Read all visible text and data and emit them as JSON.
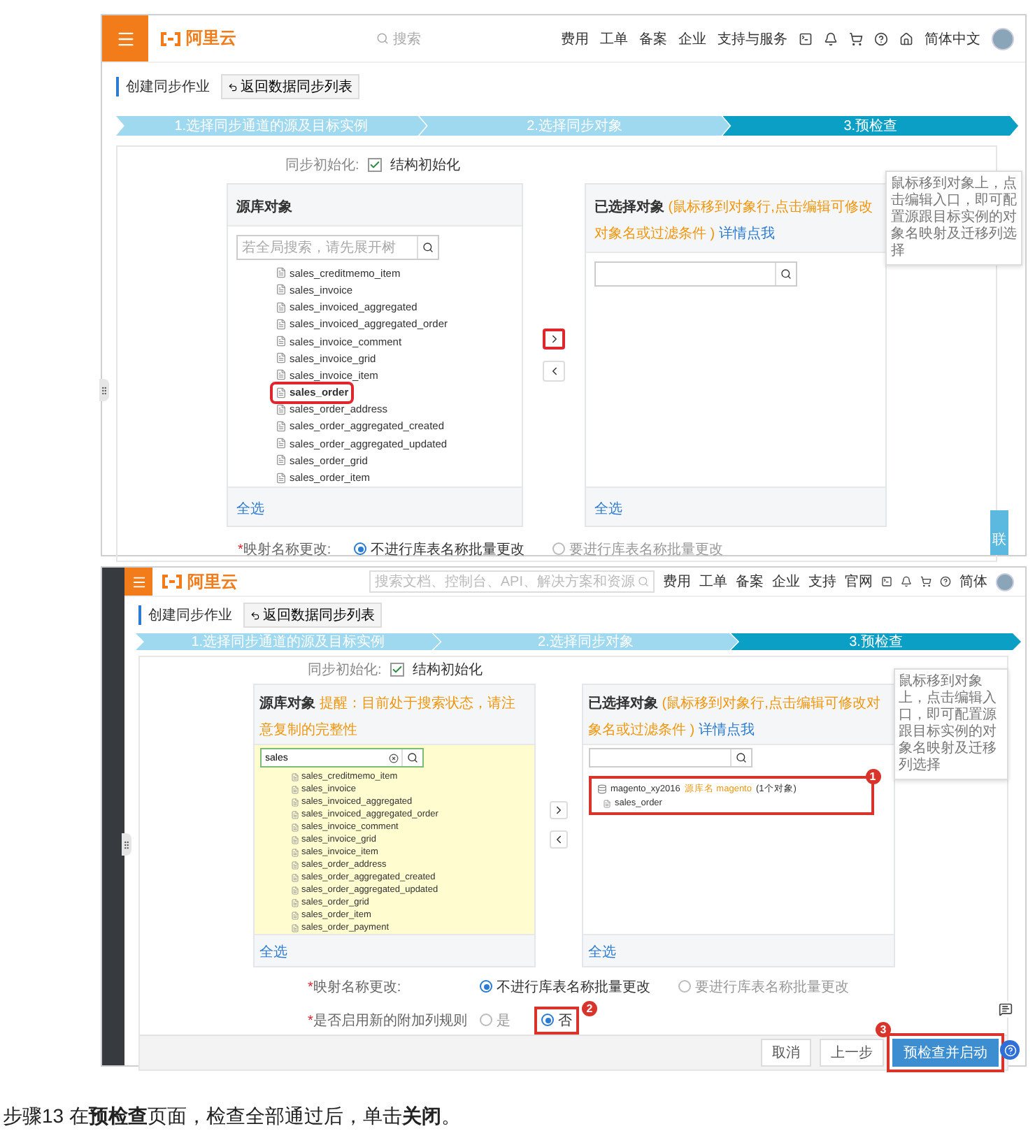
{
  "screenshots": [
    {
      "kind": "full",
      "header": {
        "logo": "阿里云",
        "search": {
          "placeholder": "搜索"
        },
        "nav": [
          "费用",
          "工单",
          "备案",
          "企业",
          "支持与服务"
        ],
        "language": "简体中文"
      },
      "page_title": "创建同步作业",
      "back_button": "返回数据同步列表",
      "steps": [
        {
          "label": "1.选择同步通道的源及目标实例",
          "selected": false
        },
        {
          "label": "2.选择同步对象",
          "selected": false
        },
        {
          "label": "3.预检查",
          "selected": true
        }
      ],
      "sync_init": {
        "label": "同步初始化:",
        "option": "结构初始化",
        "checked": true
      },
      "source": {
        "title": "源库对象",
        "search": {
          "placeholder": "若全局搜索，请先展开树"
        },
        "filtered": false,
        "items": [
          {
            "label": "sales_creditmemo_item",
            "marked": false
          },
          {
            "label": "sales_invoice",
            "marked": false
          },
          {
            "label": "sales_invoiced_aggregated",
            "marked": false
          },
          {
            "label": "sales_invoiced_aggregated_order",
            "marked": false
          },
          {
            "label": "sales_invoice_comment",
            "marked": false
          },
          {
            "label": "sales_invoice_grid",
            "marked": false
          },
          {
            "label": "sales_invoice_item",
            "marked": false
          },
          {
            "label": "sales_order",
            "marked": true
          },
          {
            "label": "sales_order_address",
            "marked": false
          },
          {
            "label": "sales_order_aggregated_created",
            "marked": false
          },
          {
            "label": "sales_order_aggregated_updated",
            "marked": false
          },
          {
            "label": "sales_order_grid",
            "marked": false
          },
          {
            "label": "sales_order_item",
            "marked": false
          }
        ],
        "select_all": "全选"
      },
      "transfer": [
        {
          "kind": "right",
          "marked": true
        },
        {
          "kind": "left",
          "marked": false
        }
      ],
      "target": {
        "title": "已选择对象",
        "hint": "(鼠标移到对象行,点击编辑可修改对象名或过滤条件 )",
        "link": "详情点我",
        "select_all": "全选"
      },
      "tooltip": "鼠标移到对象上，点击编辑入口，即可配置源跟目标实例的对象名映射及迁移列选择",
      "options": [
        {
          "required_mark": "*",
          "label": "映射名称更改:",
          "choices": [
            {
              "label": "不进行库表名称批量更改",
              "selected": true
            },
            {
              "label": "要进行库表名称批量更改",
              "selected": false
            }
          ]
        }
      ],
      "contact_tab": "联"
    },
    {
      "kind": "compact",
      "header": {
        "logo": "阿里云",
        "search": {
          "placeholder": "搜索文档、控制台、API、解决方案和资源"
        },
        "nav": [
          "费用",
          "工单",
          "备案",
          "企业",
          "支持",
          "官网"
        ],
        "language": "简体"
      },
      "page_title": "创建同步作业",
      "back_button": "返回数据同步列表",
      "steps": [
        {
          "label": "1.选择同步通道的源及目标实例",
          "selected": false
        },
        {
          "label": "2.选择同步对象",
          "selected": false
        },
        {
          "label": "3.预检查",
          "selected": true
        }
      ],
      "sync_init": {
        "label": "同步初始化:",
        "option": "结构初始化",
        "checked": true
      },
      "source": {
        "title": "源库对象",
        "notice": "提醒：目前处于搜索状态，请注意复制的完整性",
        "search": {
          "value": "sales"
        },
        "filtered": true,
        "items": [
          {
            "label": "sales_creditmemo_item",
            "marked": false
          },
          {
            "label": "sales_invoice",
            "marked": false
          },
          {
            "label": "sales_invoiced_aggregated",
            "marked": false
          },
          {
            "label": "sales_invoiced_aggregated_order",
            "marked": false
          },
          {
            "label": "sales_invoice_comment",
            "marked": false
          },
          {
            "label": "sales_invoice_grid",
            "marked": false
          },
          {
            "label": "sales_invoice_item",
            "marked": false
          },
          {
            "label": "sales_order_address",
            "marked": false
          },
          {
            "label": "sales_order_aggregated_created",
            "marked": false
          },
          {
            "label": "sales_order_aggregated_updated",
            "marked": false
          },
          {
            "label": "sales_order_grid",
            "marked": false
          },
          {
            "label": "sales_order_item",
            "marked": false
          },
          {
            "label": "sales_order_payment",
            "marked": false
          }
        ],
        "select_all": "全选"
      },
      "transfer": [
        {
          "kind": "right",
          "marked": false
        },
        {
          "kind": "left",
          "marked": false
        }
      ],
      "target": {
        "title": "已选择对象",
        "hint": "(鼠标移到对象行,点击编辑可修改对象名或过滤条件 )",
        "link": "详情点我",
        "callout": "1",
        "items": [
          {
            "label": "magento_xy2016",
            "note": "源库名 magento",
            "count": "(1个对象)",
            "children": [
              {
                "label": "sales_order"
              }
            ]
          }
        ],
        "select_all": "全选"
      },
      "tooltip": "鼠标移到对象上，点击编辑入口，即可配置源跟目标实例的对象名映射及迁移列选择",
      "options": [
        {
          "required_mark": "*",
          "label": "映射名称更改:",
          "choices": [
            {
              "label": "不进行库表名称批量更改",
              "selected": true
            },
            {
              "label": "要进行库表名称批量更改",
              "selected": false
            }
          ]
        },
        {
          "required_mark": "*",
          "label": "是否启用新的附加列规则",
          "choices": [
            {
              "label": "是",
              "selected": false
            },
            {
              "label": "否",
              "selected": true,
              "callout": "2"
            }
          ]
        }
      ],
      "footer_buttons": [
        {
          "label": "取消",
          "primary": false
        },
        {
          "label": "上一步",
          "primary": false
        },
        {
          "label": "预检查并启动",
          "primary": true,
          "callout": "3"
        }
      ]
    }
  ],
  "caption": "步骤13 在**预检查**页面，检查全部通过后，单击**关闭**。"
}
